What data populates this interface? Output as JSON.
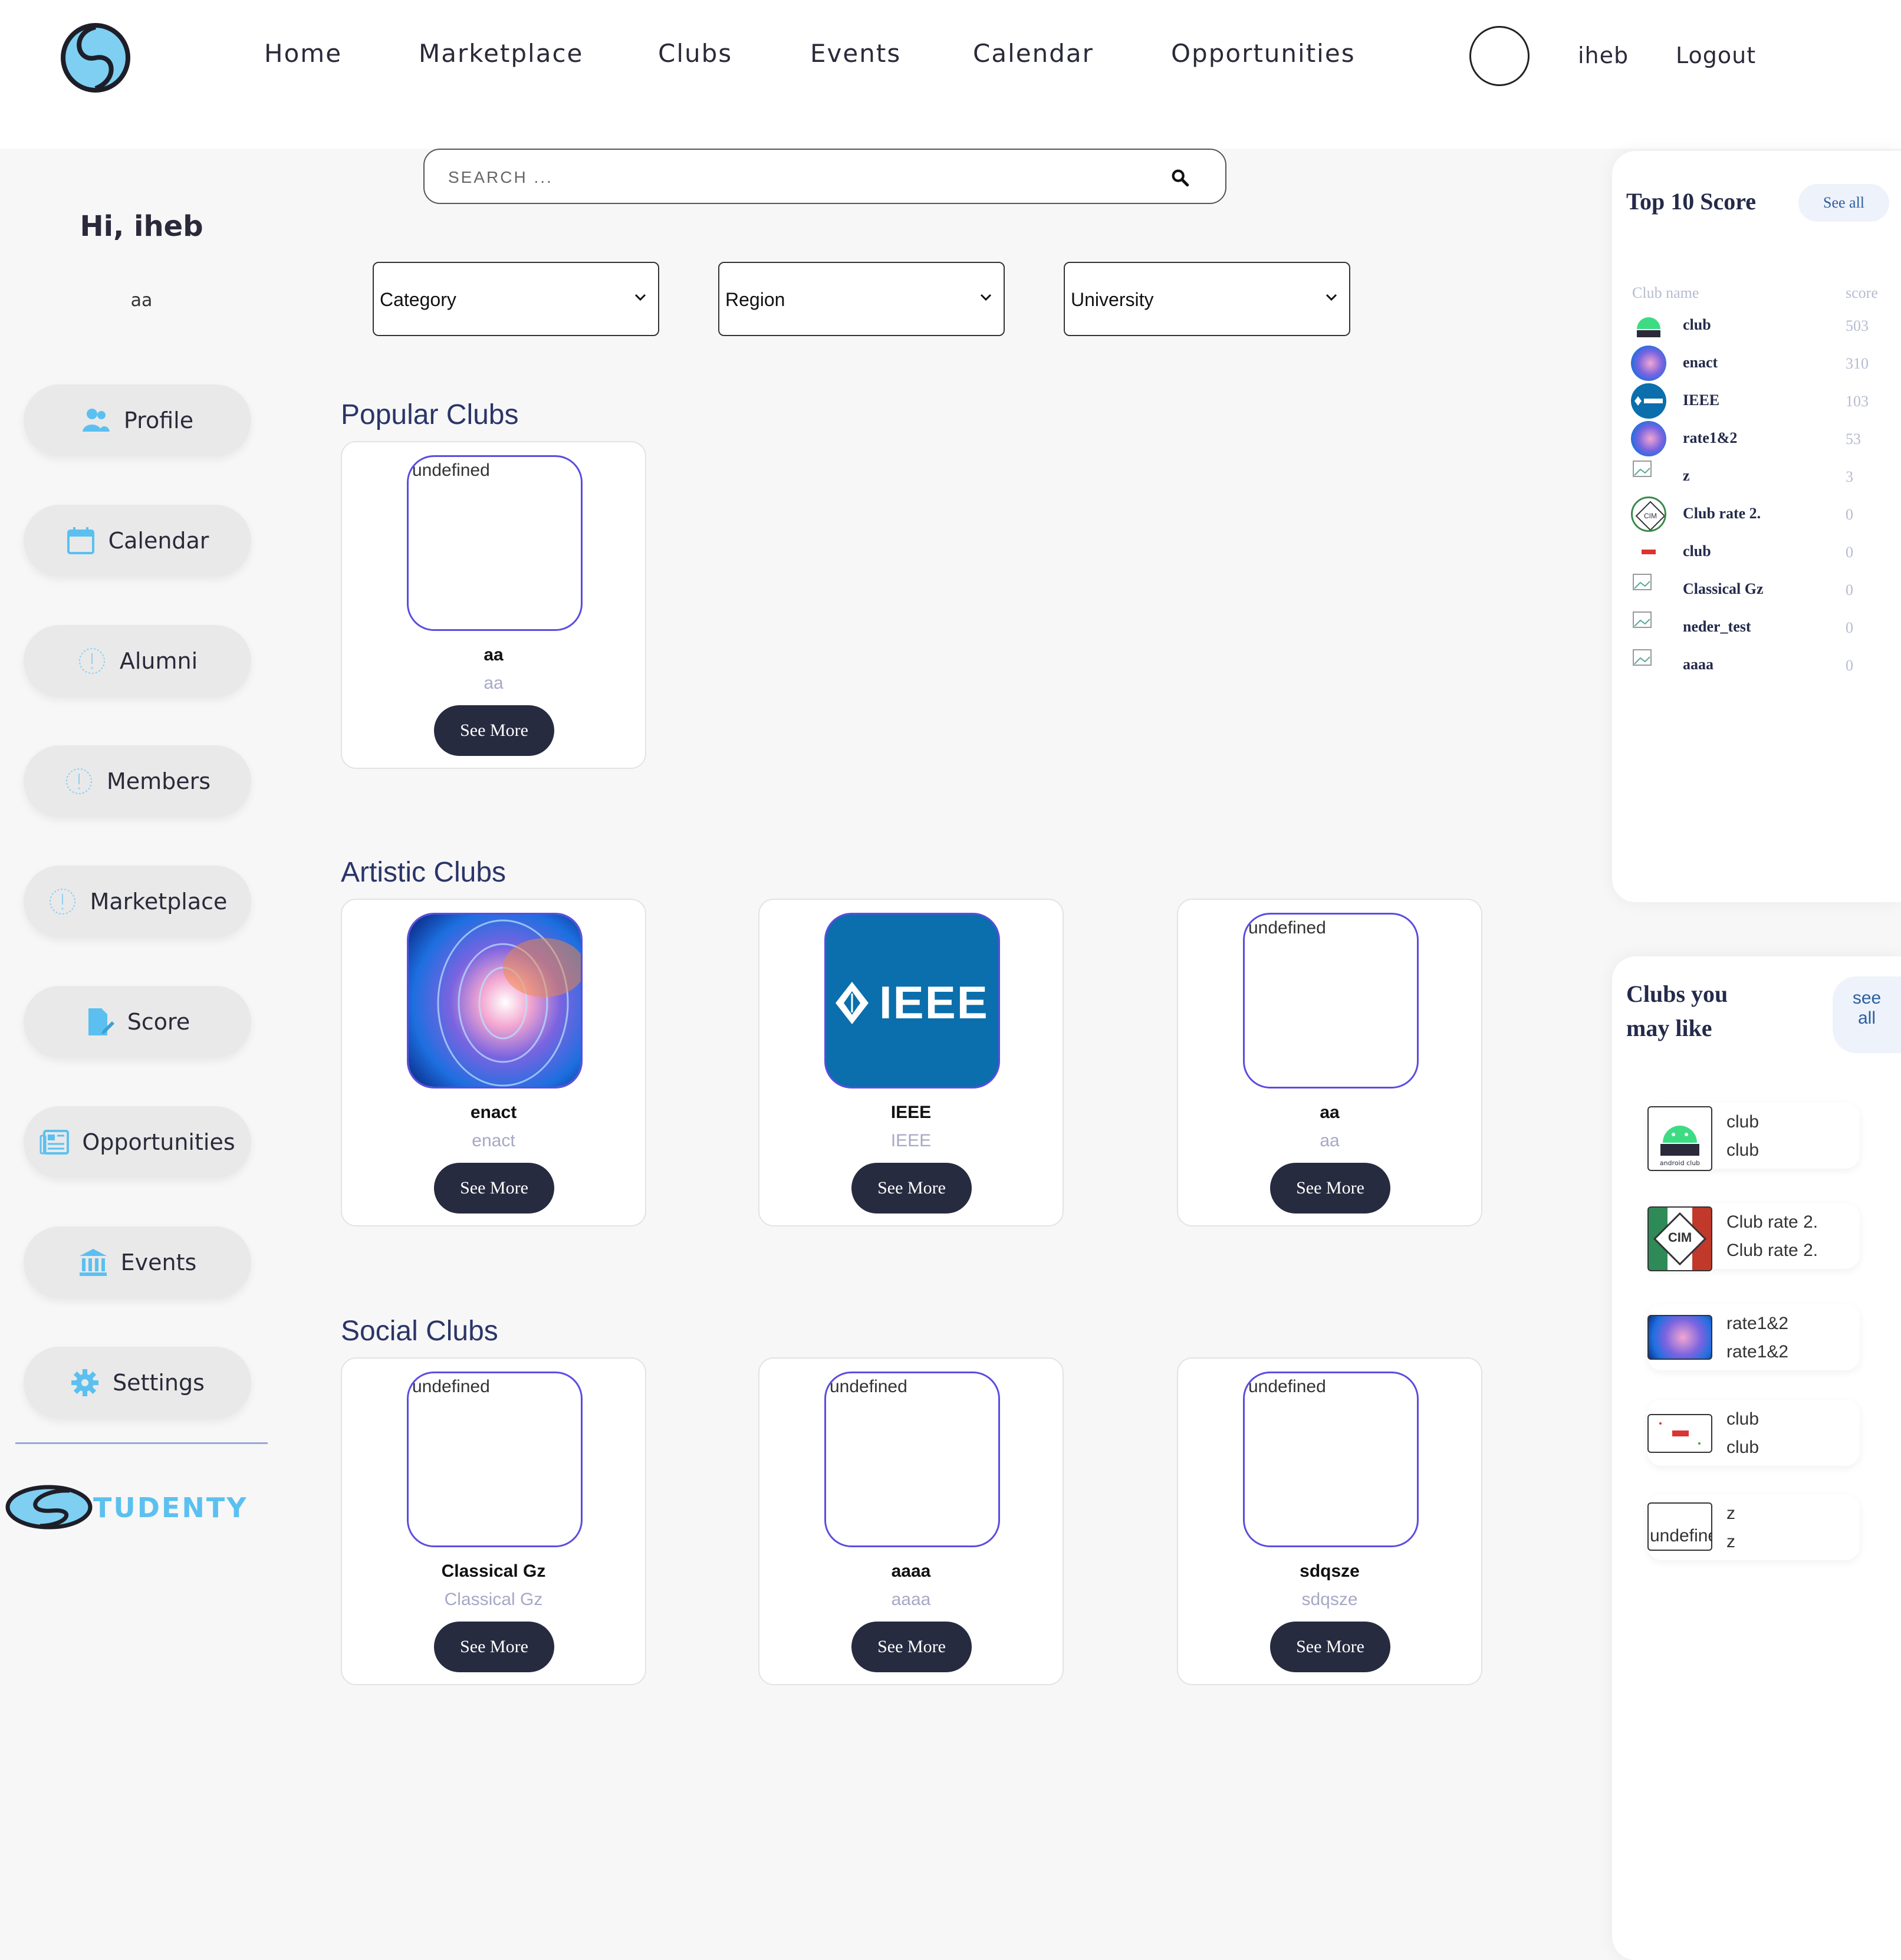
{
  "header": {
    "nav": [
      "Home",
      "Marketplace",
      "Clubs",
      "Events",
      "Calendar",
      "Opportunities"
    ],
    "username": "iheb",
    "logout": "Logout"
  },
  "search": {
    "placeholder": "SEARCH ..."
  },
  "sidebar": {
    "greeting": "Hi, iheb",
    "sub": "aa",
    "items": [
      {
        "label": "Profile",
        "icon": "users-icon"
      },
      {
        "label": "Calendar",
        "icon": "calendar-icon"
      },
      {
        "label": "Alumni",
        "icon": "info-icon"
      },
      {
        "label": "Members",
        "icon": "info-icon"
      },
      {
        "label": "Marketplace",
        "icon": "info-icon"
      },
      {
        "label": "Score",
        "icon": "document-edit-icon"
      },
      {
        "label": "Opportunities",
        "icon": "newspaper-icon"
      },
      {
        "label": "Events",
        "icon": "bank-icon"
      },
      {
        "label": "Settings",
        "icon": "gear-icon"
      }
    ],
    "brand": "TUDENTY"
  },
  "filters": {
    "category": "Category",
    "region": "Region",
    "university": "University"
  },
  "sections": {
    "popular": {
      "title": "Popular Clubs",
      "cards": [
        {
          "name": "aa",
          "sub": "aa",
          "img_alt": "undefined",
          "btn": "See More"
        }
      ]
    },
    "artistic": {
      "title": "Artistic Clubs",
      "cards": [
        {
          "name": "enact",
          "sub": "enact",
          "btn": "See More"
        },
        {
          "name": "IEEE",
          "sub": "IEEE",
          "btn": "See More",
          "logo_text": "IEEE"
        },
        {
          "name": "aa",
          "sub": "aa",
          "img_alt": "undefined",
          "btn": "See More"
        }
      ]
    },
    "social": {
      "title": "Social Clubs",
      "cards": [
        {
          "name": "Classical Gz",
          "sub": "Classical Gz",
          "img_alt": "undefined",
          "btn": "See More"
        },
        {
          "name": "aaaa",
          "sub": "aaaa",
          "img_alt": "undefined",
          "btn": "See More"
        },
        {
          "name": "sdqsze",
          "sub": "sdqsze",
          "img_alt": "undefined",
          "btn": "See More"
        }
      ]
    }
  },
  "top_score": {
    "title": "Top 10 Score",
    "see_all": "See all",
    "col_name": "Club name",
    "col_score": "score",
    "rows": [
      {
        "name": "club",
        "score": "503"
      },
      {
        "name": "enact",
        "score": "310"
      },
      {
        "name": "IEEE",
        "score": "103"
      },
      {
        "name": "rate1&2",
        "score": "53"
      },
      {
        "name": "z",
        "score": "3"
      },
      {
        "name": "Club rate 2.",
        "score": "0"
      },
      {
        "name": "club",
        "score": "0"
      },
      {
        "name": "Classical Gz",
        "score": "0"
      },
      {
        "name": "neder_test",
        "score": "0"
      },
      {
        "name": "aaaa",
        "score": "0"
      }
    ]
  },
  "clubs_like": {
    "title_l1": "Clubs you",
    "title_l2": "may like",
    "see_l1": "see",
    "see_l2": "all",
    "rows": [
      {
        "t1": "club",
        "t2": "club",
        "logo_text": "android club"
      },
      {
        "t1": "Club rate 2.",
        "t2": "Club rate 2.",
        "logo_text": "CIM"
      },
      {
        "t1": "rate1&2",
        "t2": "rate1&2"
      },
      {
        "t1": "club",
        "t2": "club"
      },
      {
        "t1": "z",
        "t2": "z",
        "img_alt": "undefined"
      }
    ]
  },
  "colors": {
    "accent": "#2b3568",
    "button": "#272b40",
    "icon_blue": "#5bc0f0",
    "card_border": "#5b4ce0"
  }
}
